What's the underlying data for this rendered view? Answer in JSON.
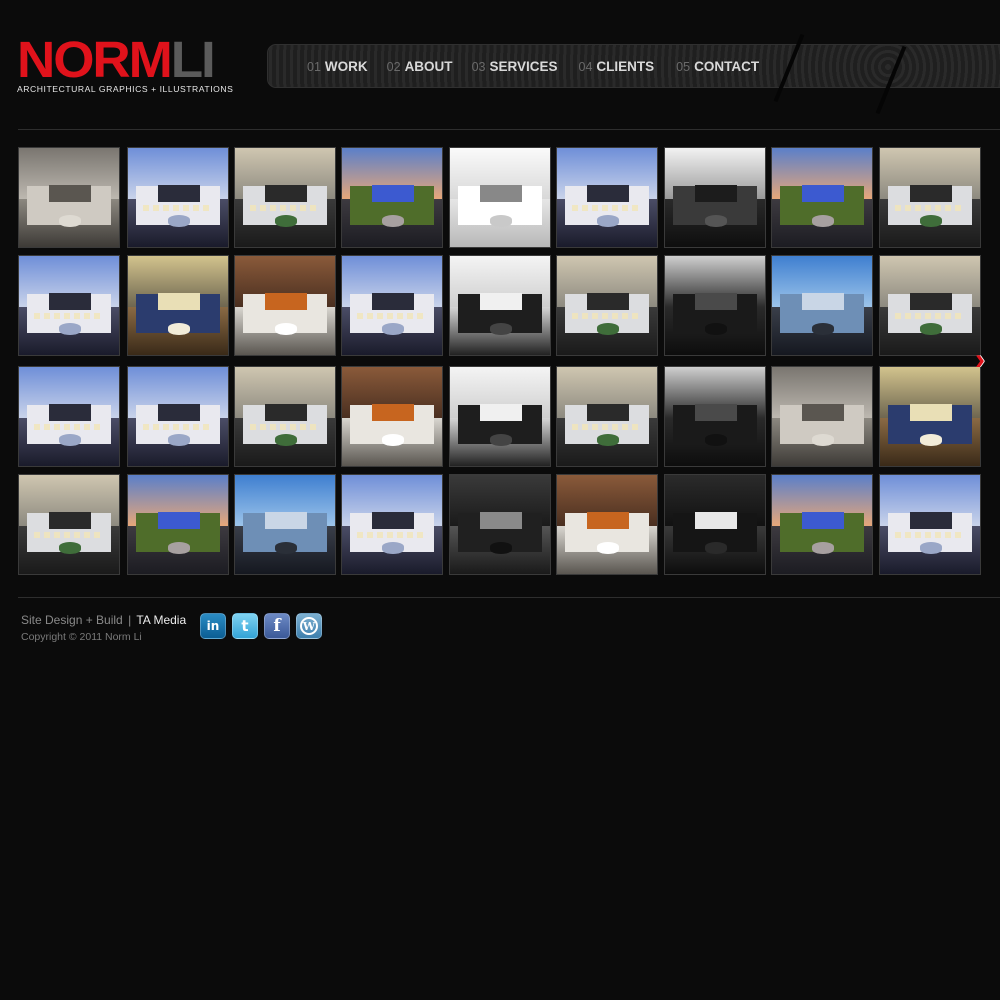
{
  "logo": {
    "word_red": "NORM",
    "word_grey": "LI",
    "subtitle": "ARCHITECTURAL GRAPHICS + ILLUSTRATIONS"
  },
  "nav": [
    {
      "num": "01",
      "label": "WORK"
    },
    {
      "num": "02",
      "label": "ABOUT"
    },
    {
      "num": "03",
      "label": "SERVICES"
    },
    {
      "num": "04",
      "label": "CLIENTS"
    },
    {
      "num": "05",
      "label": "CONTACT"
    }
  ],
  "gallery": {
    "rows": [
      [
        "lobby",
        "mansion",
        "modern",
        "street",
        "ceiling",
        "mansion",
        "ceiling-dark",
        "street",
        "modern"
      ],
      [
        "mansion",
        "dining",
        "lounge",
        "mansion",
        "gallery-white",
        "modern",
        "screen-wall",
        "towers",
        "modern"
      ],
      [
        "mansion",
        "mansion",
        "modern",
        "lounge",
        "gallery-white",
        "modern",
        "screen-wall",
        "lobby",
        "dining"
      ],
      [
        "modern",
        "street",
        "towers",
        "mansion",
        "restaurant",
        "lounge",
        "bar",
        "street",
        "mansion"
      ]
    ],
    "next_icon": "chevron-right-icon",
    "accent_color": "#e0121b"
  },
  "footer": {
    "credit_prefix": "Site Design + Build",
    "credit_sep": "|",
    "credit_link": "TA Media",
    "copyright": "Copyright © 2011 Norm Li"
  },
  "socials": [
    {
      "name": "linkedin-icon",
      "glyph": "in"
    },
    {
      "name": "twitter-icon",
      "glyph": "t"
    },
    {
      "name": "facebook-icon",
      "glyph": "f"
    },
    {
      "name": "wordpress-icon",
      "glyph": "W"
    }
  ]
}
